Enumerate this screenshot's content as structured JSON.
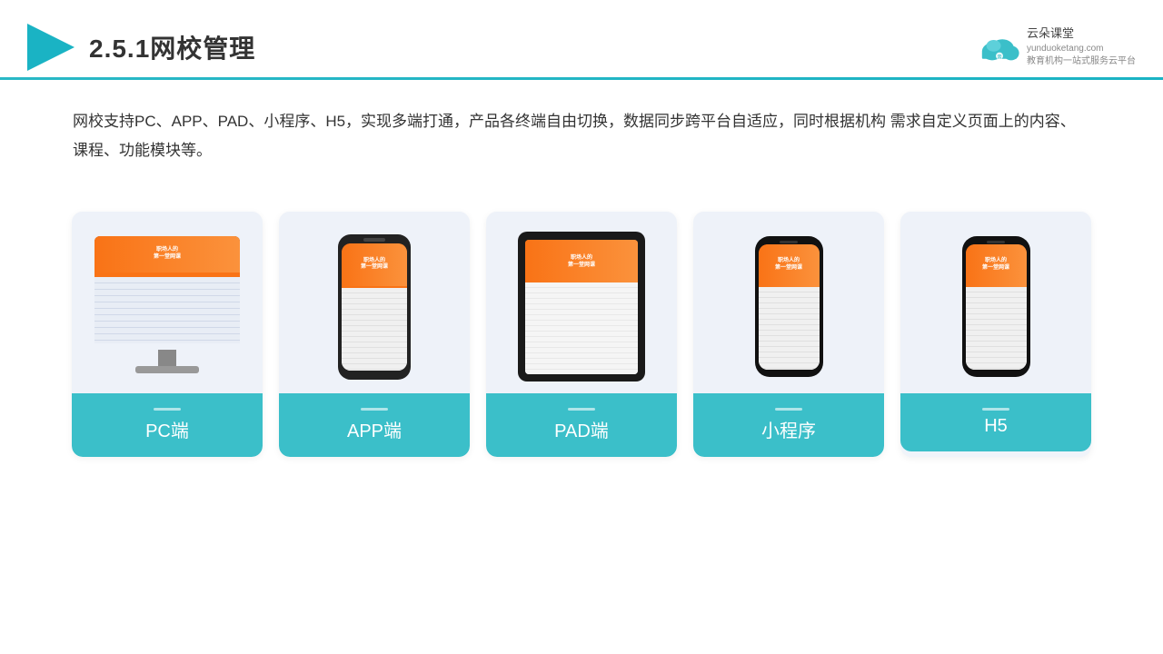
{
  "header": {
    "title": "2.5.1网校管理",
    "logo_cn": "云朵课堂",
    "logo_url": "yunduoketang.com",
    "logo_tagline": "教育机构一站\n式服务云平台"
  },
  "description": "网校支持PC、APP、PAD、小程序、H5，实现多端打通，产品各终端自由切换，数据同步跨平台自适应，同时根据机构\n需求自定义页面上的内容、课程、功能模块等。",
  "cards": [
    {
      "id": "pc",
      "label": "PC端"
    },
    {
      "id": "app",
      "label": "APP端"
    },
    {
      "id": "pad",
      "label": "PAD端"
    },
    {
      "id": "miniapp",
      "label": "小程序"
    },
    {
      "id": "h5",
      "label": "H5"
    }
  ],
  "colors": {
    "teal": "#3bbfc9",
    "divider": "#29b8c6",
    "orange": "#f97316"
  }
}
